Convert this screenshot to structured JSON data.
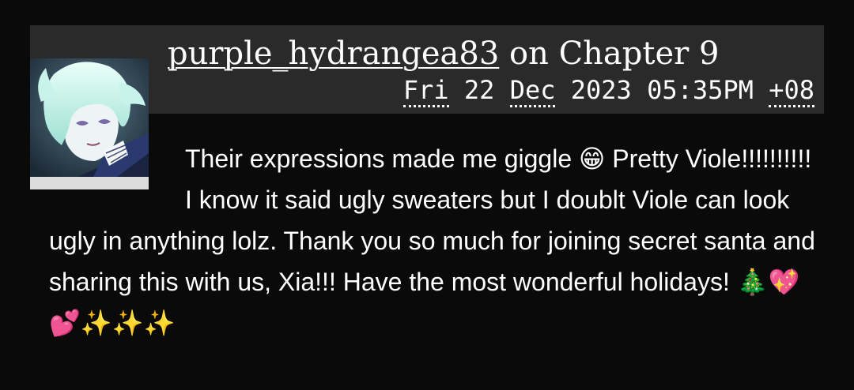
{
  "comment": {
    "author": "purple_hydrangea83",
    "heading_connector": " on ",
    "work_chapter": "Chapter 9",
    "datetime": {
      "day": "Fri",
      "date": " 22 ",
      "month": "Dec",
      "year_time": " 2023 05:35PM ",
      "timezone": "+08"
    },
    "avatar_alt": "purple_hydrangea83",
    "text_part1": "Their expressions made me giggle ",
    "emoji_grin": "😁",
    "text_part2": " Pretty Viole!!!!!!!!!! I know it said ugly sweaters but I doublt Viole can look ugly in anything lolz. Thank you so much for joining secret santa and sharing this with us, Xia!!! Have the most wonderful holidays! ",
    "emoji_trail": "🎄💖💕✨✨✨"
  }
}
